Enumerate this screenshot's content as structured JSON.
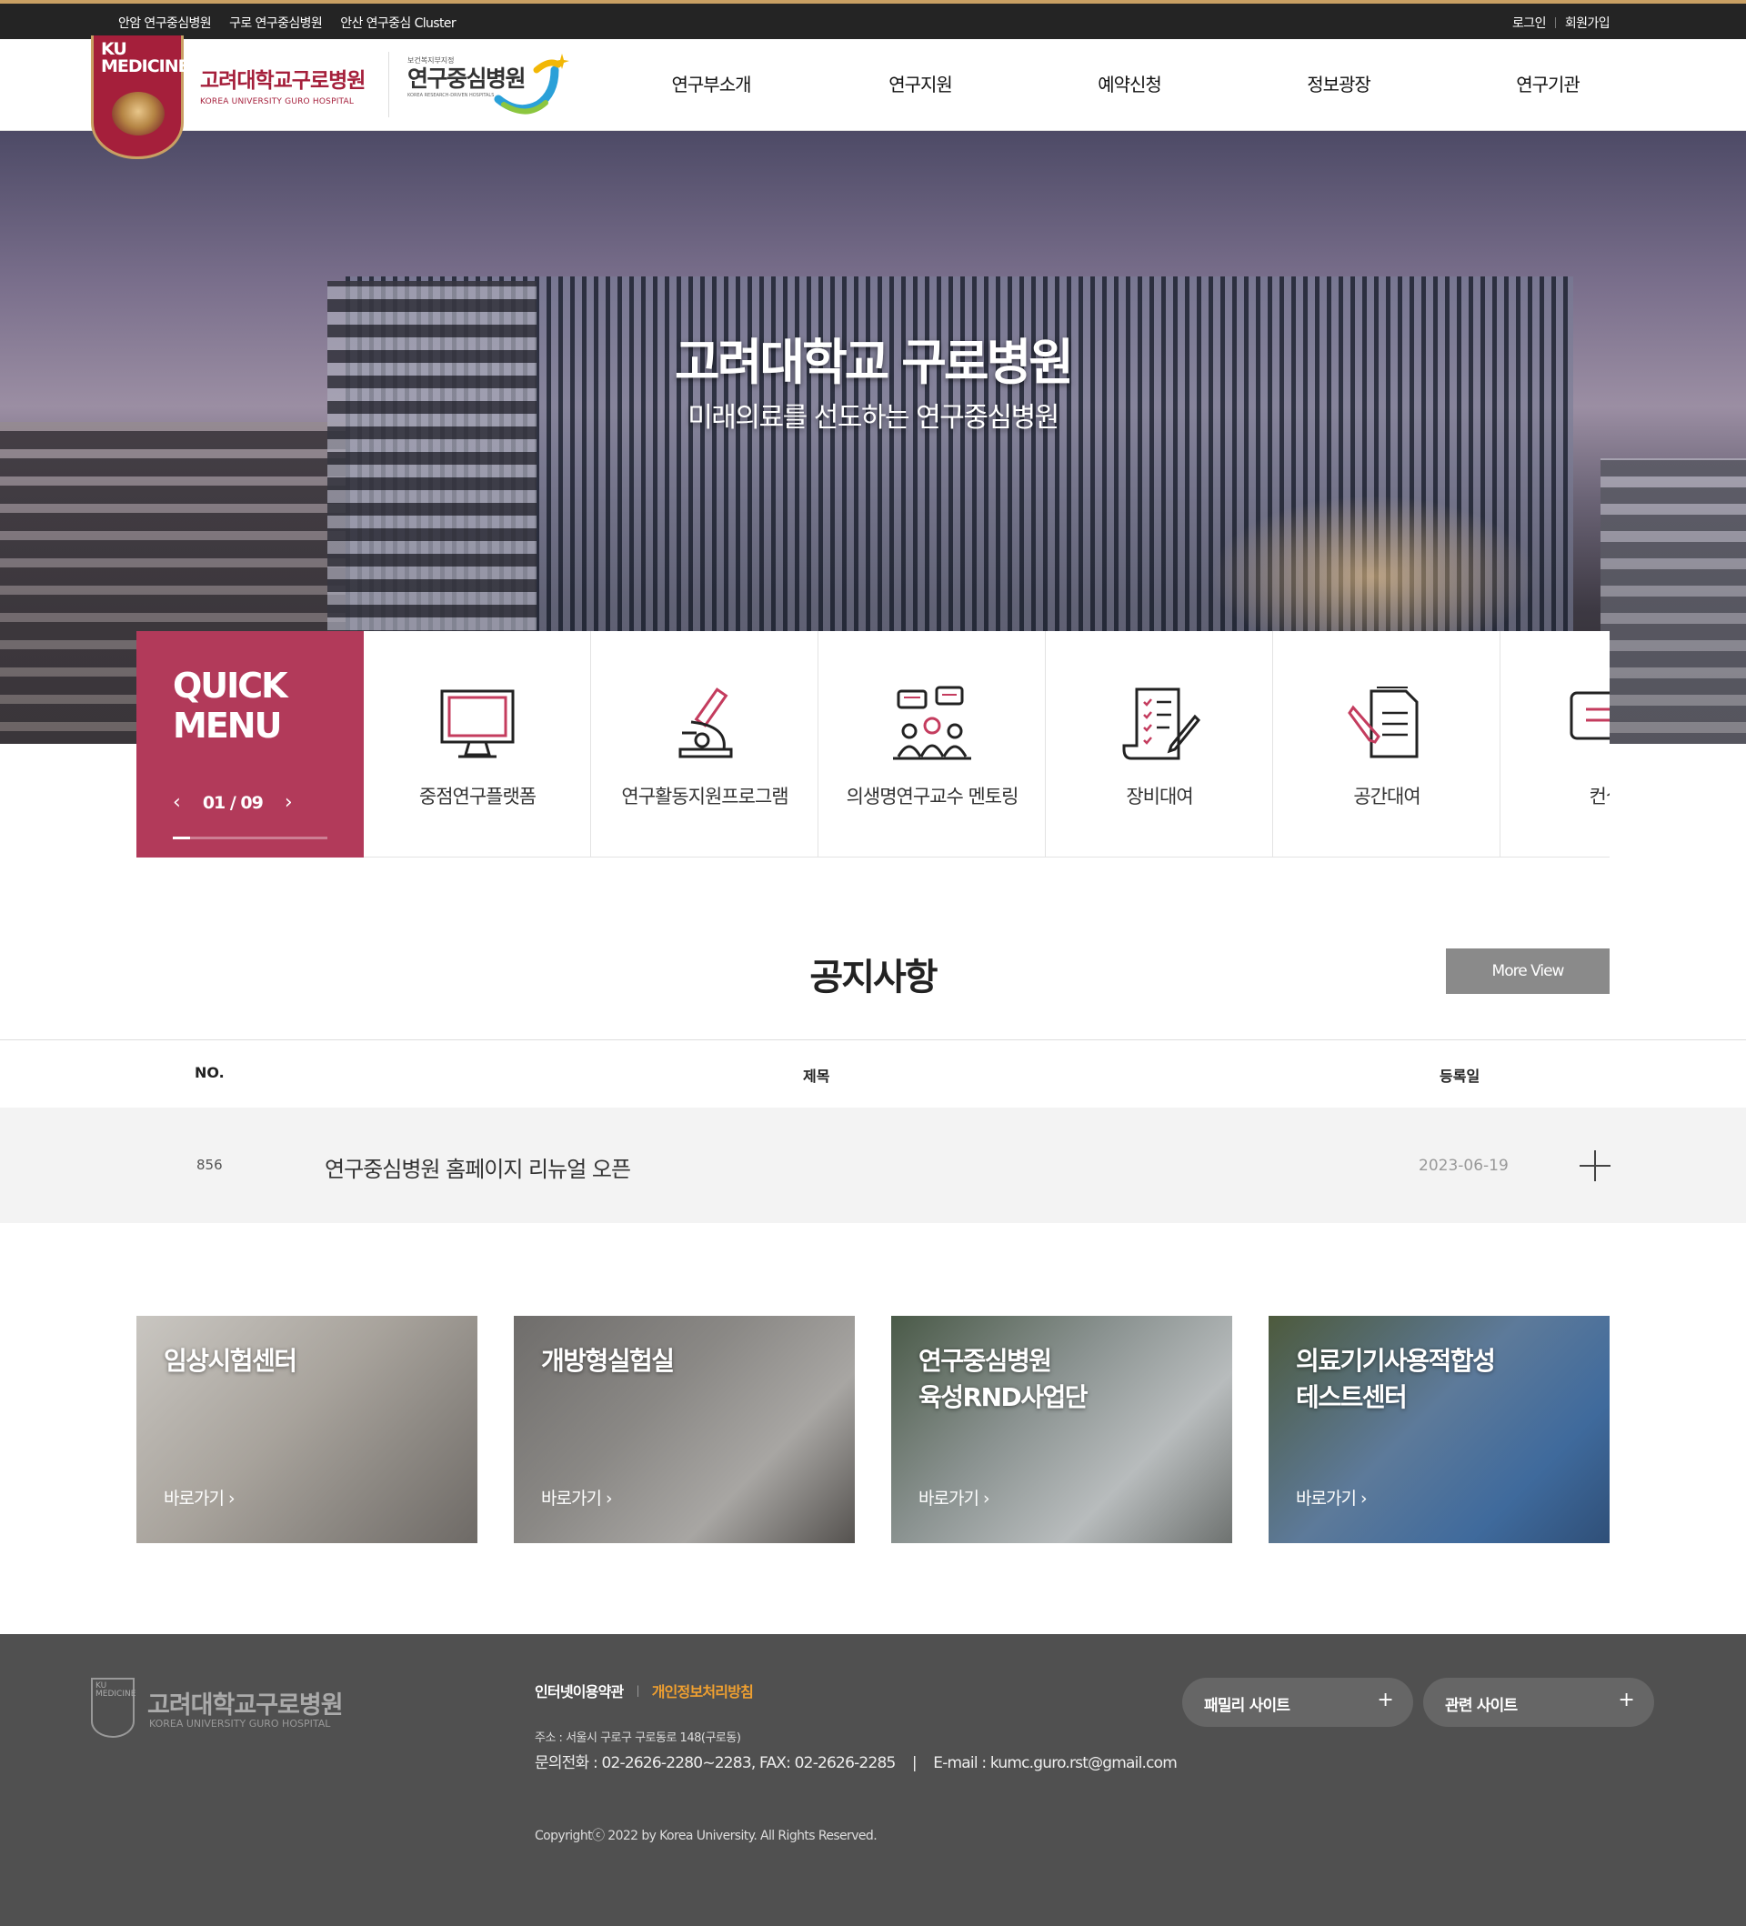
{
  "topbar": {
    "links": [
      "안암 연구중심병원",
      "구로 연구중심병원",
      "안산 연구중심 Cluster"
    ],
    "login": "로그인",
    "signup": "회원가입"
  },
  "header": {
    "shield_text": "KU\nMEDICINE",
    "brand_ko": "고려대학교구로병원",
    "brand_en": "KOREA UNIVERSITY GURO HOSPITAL",
    "rh_small": "보건복지부지정",
    "rh_big": "연구중심병원",
    "rh_tiny": "KOREA RESEARCH-DRIVEN HOSPITALS",
    "nav": [
      "연구부소개",
      "연구지원",
      "예약신청",
      "정보광장",
      "연구기관"
    ]
  },
  "hero": {
    "title": "고려대학교 구로병원",
    "subtitle": "미래의료를 선도하는 연구중심병원"
  },
  "quick_menu": {
    "title_line1": "QUICK",
    "title_line2": "MENU",
    "prev": "‹",
    "next": "›",
    "pager": "01 / 09",
    "progress": 0.11,
    "items": [
      {
        "label": "중점연구플랫폼",
        "icon": "monitor-icon"
      },
      {
        "label": "연구활동지원프로그램",
        "icon": "microscope-icon"
      },
      {
        "label": "의생명연구교수 멘토링",
        "icon": "mentoring-icon"
      },
      {
        "label": "장비대여",
        "icon": "checklist-icon"
      },
      {
        "label": "공간대여",
        "icon": "document-pen-icon"
      },
      {
        "label": "컨설팅",
        "icon": "consult-icon"
      }
    ]
  },
  "notice": {
    "title": "공지사항",
    "more": "More View",
    "headers": {
      "no": "NO.",
      "subject": "제목",
      "date": "등록일"
    },
    "rows": [
      {
        "no": "856",
        "title": "연구중심병원 홈페이지 리뉴얼 오픈",
        "date": "2023-06-19"
      }
    ]
  },
  "cards": [
    {
      "title": "임상시험센터",
      "go": "바로가기 ›"
    },
    {
      "title": "개방형실험실",
      "go": "바로가기 ›"
    },
    {
      "title": "연구중심병원\n육성RND사업단",
      "go": "바로가기 ›"
    },
    {
      "title": "의료기기사용적합성\n테스트센터",
      "go": "바로가기 ›"
    }
  ],
  "footer": {
    "logo_ko": "고려대학교구로병원",
    "logo_en": "KOREA UNIVERSITY GURO HOSPITAL",
    "logo_mark": "KU\nMEDICINE",
    "link_terms": "인터넷이용약관",
    "link_privacy": "개인정보처리방침",
    "address": "주소 : 서울시 구로구 구로동로 148(구로동)",
    "contact": "문의전화 : 02-2626-2280~2283, FAX: 02-2626-2285    |    E-mail : kumc.guro.rst@gmail.com",
    "copyright": "Copyrightⓒ 2022 by Korea University. All Rights Reserved.",
    "family_site": "패밀리 사이트",
    "related_site": "관련 사이트",
    "plus": "+"
  },
  "colors": {
    "accent": "#b23a5a",
    "brand": "#a51f3b",
    "gold": "#c9a063",
    "footer": "#505050"
  }
}
